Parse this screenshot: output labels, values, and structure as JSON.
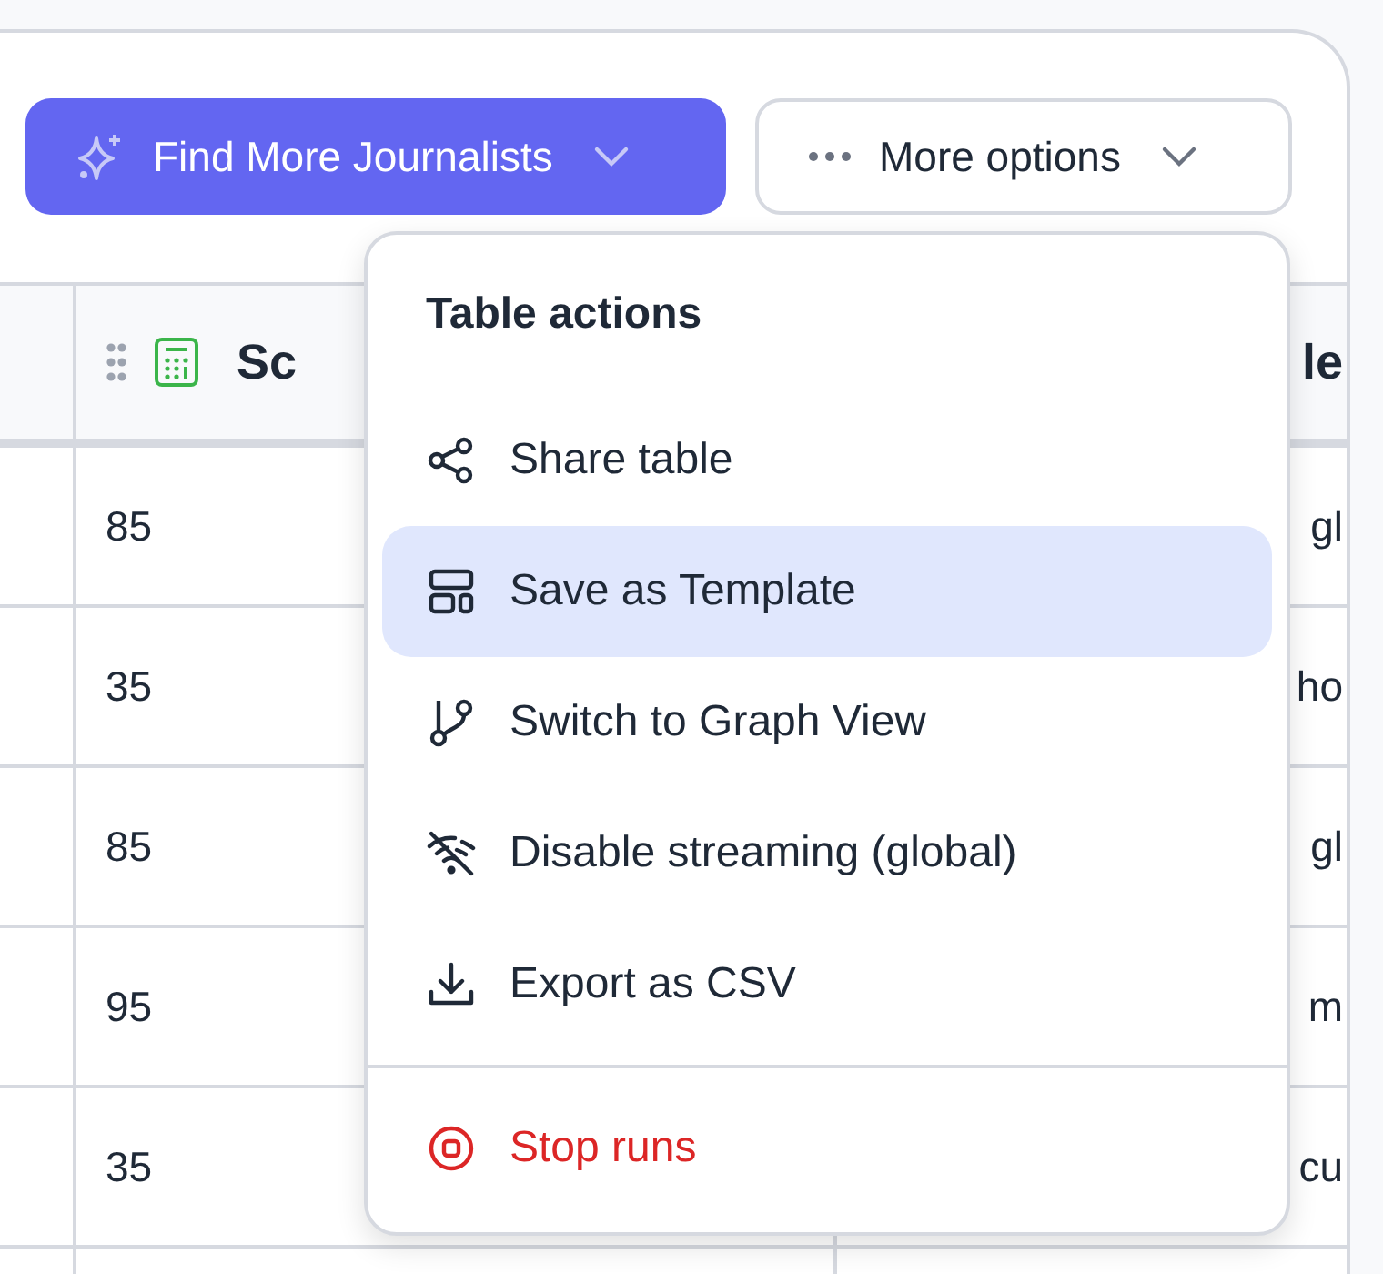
{
  "toolbar": {
    "buttons": [
      {
        "label": "Find More Journalists",
        "kind": "primary"
      },
      {
        "label": "More options",
        "kind": "secondary"
      }
    ]
  },
  "table": {
    "columns": [
      {
        "label": "Sc"
      },
      {
        "label": "le"
      }
    ],
    "rows": [
      {
        "column_2": "85",
        "column_3": "gl"
      },
      {
        "column_2": "35",
        "column_3": "ho"
      },
      {
        "column_2": "85",
        "column_3": "gl"
      },
      {
        "column_2": "95",
        "column_3": "m"
      },
      {
        "column_2": "35",
        "column_3": "cu"
      }
    ]
  },
  "menu": {
    "title": "Table actions",
    "items": [
      {
        "label": "Share table",
        "kind": "action",
        "selected": false
      },
      {
        "label": "Save as Template",
        "kind": "action",
        "selected": true
      },
      {
        "label": "Switch to Graph View",
        "kind": "action",
        "selected": false
      },
      {
        "label": "Disable streaming (global)",
        "kind": "action",
        "selected": false
      },
      {
        "label": "Export as CSV",
        "kind": "action",
        "selected": false
      },
      {
        "label": "Stop runs",
        "kind": "danger",
        "selected": false
      }
    ]
  }
}
